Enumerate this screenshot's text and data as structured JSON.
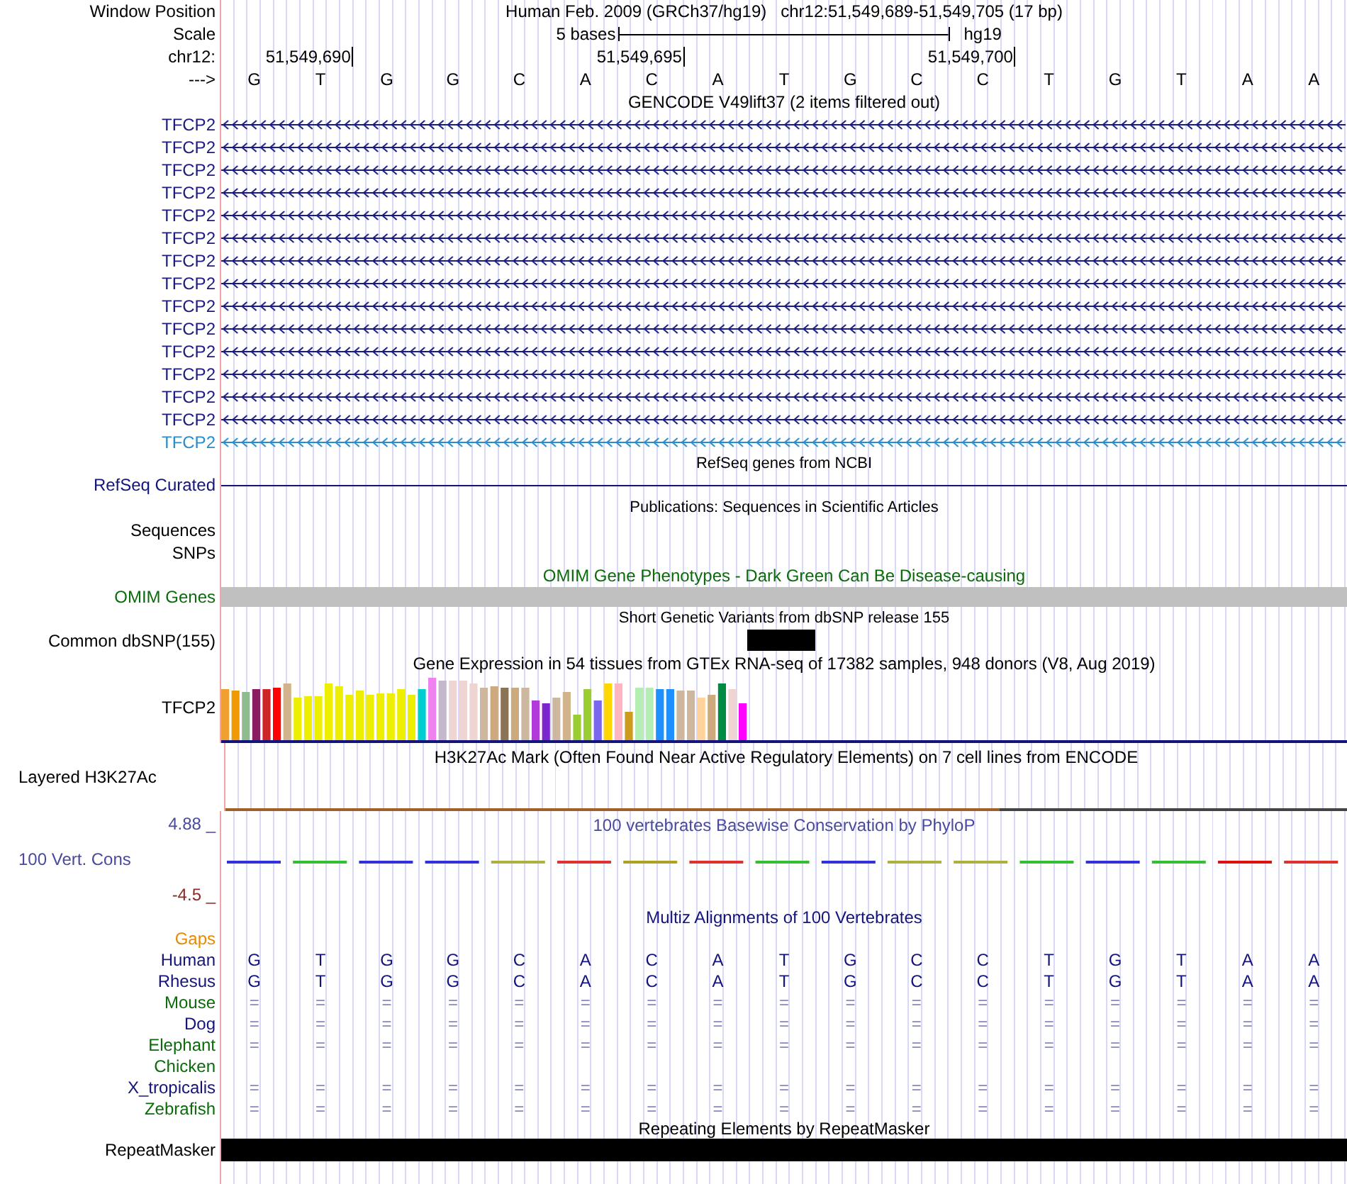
{
  "header": {
    "window_label": "Window Position",
    "title": "Human Feb. 2009 (GRCh37/hg19)   chr12:51,549,689-51,549,705 (17 bp)",
    "scale_label": "Scale",
    "scale_text": "5 bases",
    "assembly": "hg19",
    "chrom_label": "chr12:",
    "positions": [
      "51,549,690",
      "51,549,695",
      "51,549,700"
    ],
    "strand_label": "--->",
    "bases": [
      "G",
      "T",
      "G",
      "G",
      "C",
      "A",
      "C",
      "A",
      "T",
      "G",
      "C",
      "C",
      "T",
      "G",
      "T",
      "A",
      "A"
    ]
  },
  "gencode": {
    "title": "GENCODE V49lift37 (2 items filtered out)",
    "transcripts": [
      {
        "name": "TFCP2",
        "color": "#1a1a80"
      },
      {
        "name": "TFCP2",
        "color": "#1a1a80"
      },
      {
        "name": "TFCP2",
        "color": "#1a1a80"
      },
      {
        "name": "TFCP2",
        "color": "#1a1a80"
      },
      {
        "name": "TFCP2",
        "color": "#1a1a80"
      },
      {
        "name": "TFCP2",
        "color": "#1a1a80"
      },
      {
        "name": "TFCP2",
        "color": "#1a1a80"
      },
      {
        "name": "TFCP2",
        "color": "#1a1a80"
      },
      {
        "name": "TFCP2",
        "color": "#1a1a80"
      },
      {
        "name": "TFCP2",
        "color": "#1a1a80"
      },
      {
        "name": "TFCP2",
        "color": "#1a1a80"
      },
      {
        "name": "TFCP2",
        "color": "#1a1a80"
      },
      {
        "name": "TFCP2",
        "color": "#1a1a80"
      },
      {
        "name": "TFCP2",
        "color": "#1a1a80"
      },
      {
        "name": "TFCP2",
        "color": "#2a8ccc"
      }
    ]
  },
  "refseq": {
    "title": "RefSeq genes from NCBI",
    "label": "RefSeq Curated"
  },
  "publications": {
    "title": "Publications: Sequences in Scientific Articles",
    "labels": [
      "Sequences",
      "SNPs"
    ]
  },
  "omim": {
    "title": "OMIM Gene Phenotypes - Dark Green Can Be Disease-causing",
    "label": "OMIM Genes"
  },
  "dbsnp": {
    "title": "Short Genetic Variants from dbSNP release 155",
    "label": "Common dbSNP(155)"
  },
  "gtex": {
    "title": "Gene Expression in 54 tissues from GTEx RNA-seq of 17382 samples, 948 donors (V8, Aug 2019)",
    "label": "TFCP2"
  },
  "h3k27ac": {
    "title": "H3K27Ac Mark (Often Found Near Active Regulatory Elements) on 7 cell lines from ENCODE",
    "label": "Layered H3K27Ac"
  },
  "conservation": {
    "title": "100 vertebrates Basewise Conservation by PhyloP",
    "label": "100 Vert. Cons",
    "max": "4.88 _",
    "min": "-4.5 _"
  },
  "multiz": {
    "title": "Multiz Alignments of 100 Vertebrates",
    "species": [
      {
        "name": "Gaps",
        "color": "#e68a00",
        "kind": "none"
      },
      {
        "name": "Human",
        "color": "#14147a",
        "kind": "bases",
        "cells": [
          "G",
          "T",
          "G",
          "G",
          "C",
          "A",
          "C",
          "A",
          "T",
          "G",
          "C",
          "C",
          "T",
          "G",
          "T",
          "A",
          "A"
        ]
      },
      {
        "name": "Rhesus",
        "color": "#14147a",
        "kind": "bases",
        "cells": [
          "G",
          "T",
          "G",
          "G",
          "C",
          "A",
          "C",
          "A",
          "T",
          "G",
          "C",
          "C",
          "T",
          "G",
          "T",
          "A",
          "A"
        ]
      },
      {
        "name": "Mouse",
        "color": "#0b6b0b",
        "kind": "match",
        "cells": [
          "=",
          "=",
          "=",
          "=",
          "=",
          "=",
          "=",
          "=",
          "=",
          "=",
          "=",
          "=",
          "=",
          "=",
          "=",
          "=",
          "="
        ]
      },
      {
        "name": "Dog",
        "color": "#14147a",
        "kind": "match",
        "cells": [
          "=",
          "=",
          "=",
          "=",
          "=",
          "=",
          "=",
          "=",
          "=",
          "=",
          "=",
          "=",
          "=",
          "=",
          "=",
          "=",
          "="
        ]
      },
      {
        "name": "Elephant",
        "color": "#0b6b0b",
        "kind": "match",
        "cells": [
          "=",
          "=",
          "=",
          "=",
          "=",
          "=",
          "=",
          "=",
          "=",
          "=",
          "=",
          "=",
          "=",
          "=",
          "=",
          "=",
          "="
        ]
      },
      {
        "name": "Chicken",
        "color": "#0b6b0b",
        "kind": "none"
      },
      {
        "name": "X_tropicalis",
        "color": "#14147a",
        "kind": "match",
        "cells": [
          "=",
          "=",
          "=",
          "=",
          "=",
          "=",
          "=",
          "=",
          "=",
          "=",
          "=",
          "=",
          "=",
          "=",
          "=",
          "=",
          "="
        ]
      },
      {
        "name": "Zebrafish",
        "color": "#0b6b0b",
        "kind": "match",
        "cells": [
          "=",
          "=",
          "=",
          "=",
          "=",
          "=",
          "=",
          "=",
          "=",
          "=",
          "=",
          "=",
          "=",
          "=",
          "=",
          "=",
          "="
        ]
      }
    ]
  },
  "repeatmasker": {
    "title": "Repeating Elements by RepeatMasker",
    "label": "RepeatMasker"
  }
}
